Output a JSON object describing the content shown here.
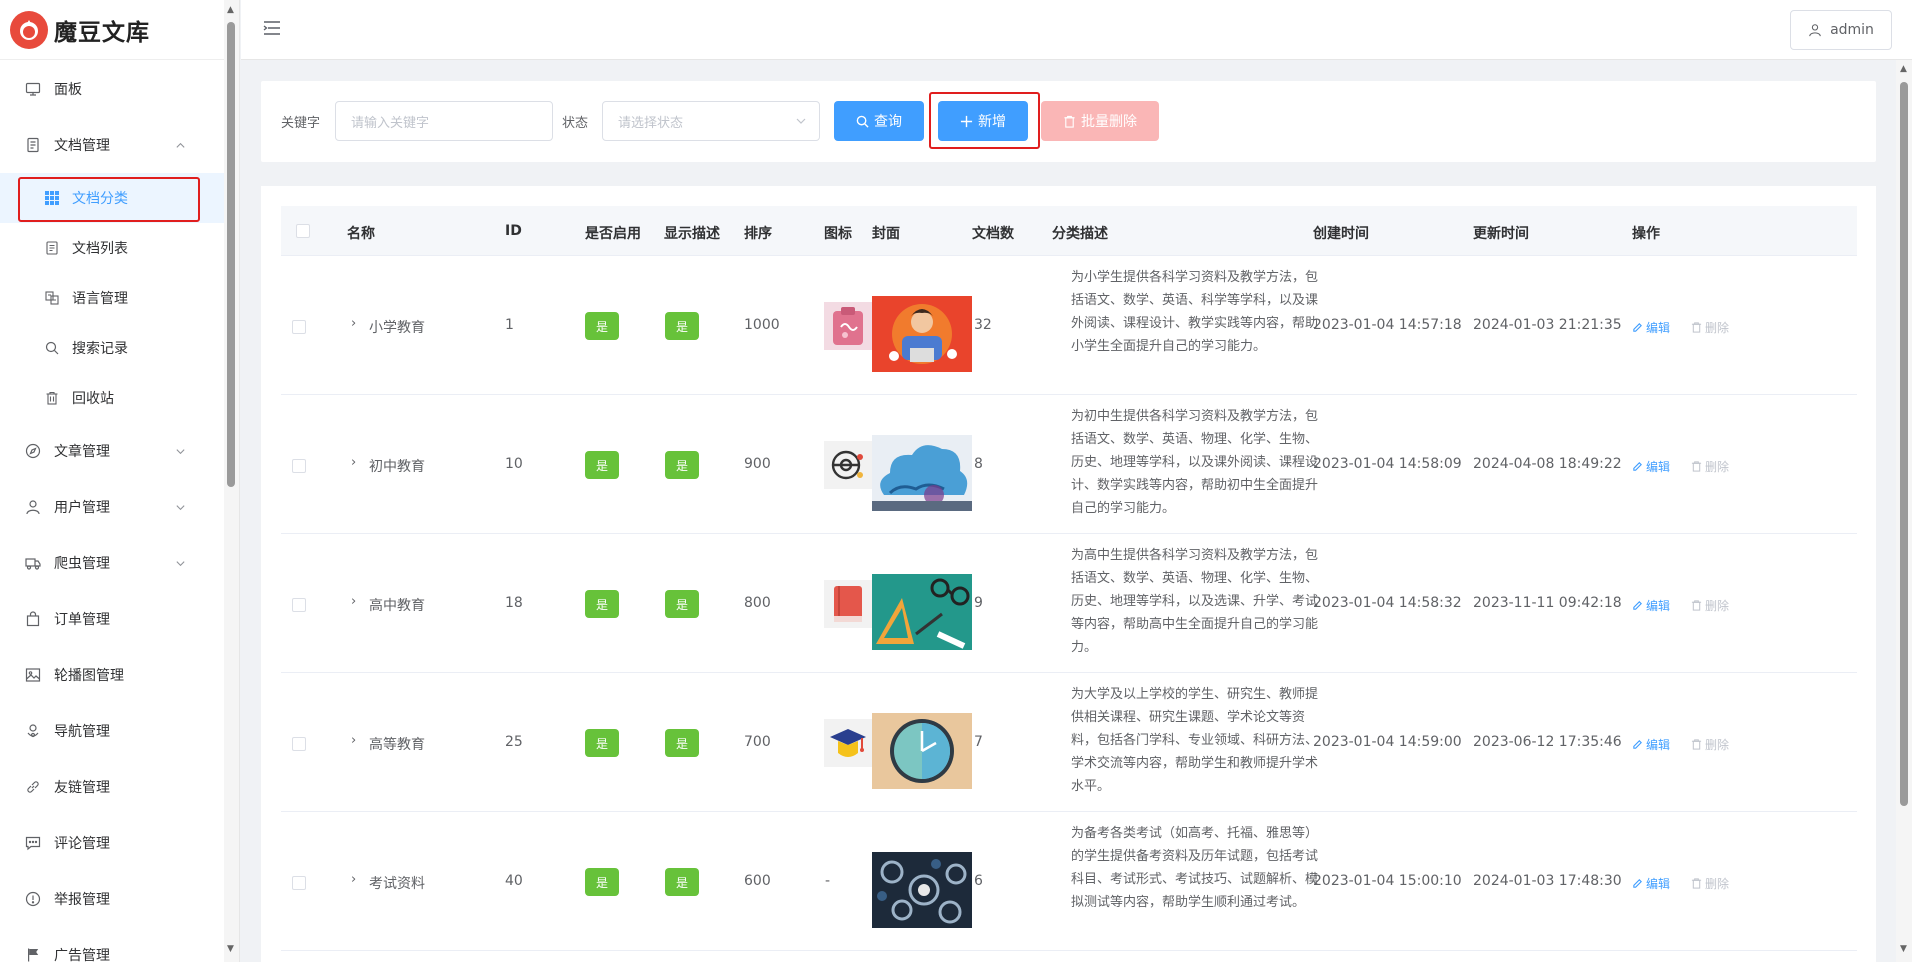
{
  "app": {
    "title": "魔豆文库"
  },
  "sidebar": {
    "items": [
      {
        "label": "面板",
        "icon": "monitor-icon"
      },
      {
        "label": "文档管理",
        "icon": "document-icon",
        "expanded": true
      },
      {
        "label": "文章管理",
        "icon": "compass-icon"
      },
      {
        "label": "用户管理",
        "icon": "user-icon"
      },
      {
        "label": "爬虫管理",
        "icon": "truck-icon"
      },
      {
        "label": "订单管理",
        "icon": "bag-icon"
      },
      {
        "label": "轮播图管理",
        "icon": "picture-icon"
      },
      {
        "label": "导航管理",
        "icon": "navigation-icon"
      },
      {
        "label": "友链管理",
        "icon": "link-icon"
      },
      {
        "label": "评论管理",
        "icon": "comment-icon"
      },
      {
        "label": "举报管理",
        "icon": "warning-icon"
      },
      {
        "label": "广告管理",
        "icon": "flag-icon"
      }
    ],
    "subitems": [
      {
        "label": "文档分类",
        "icon": "grid-icon",
        "active": true
      },
      {
        "label": "文档列表",
        "icon": "list-icon"
      },
      {
        "label": "语言管理",
        "icon": "translate-icon"
      },
      {
        "label": "搜索记录",
        "icon": "search-icon"
      },
      {
        "label": "回收站",
        "icon": "trash-icon"
      }
    ]
  },
  "header": {
    "user": "admin"
  },
  "filter": {
    "keyword_label": "关键字",
    "keyword_placeholder": "请输入关键字",
    "status_label": "状态",
    "status_placeholder": "请选择状态",
    "query_label": "查询",
    "add_label": "新增",
    "batch_delete_label": "批量删除"
  },
  "table": {
    "columns": [
      "名称",
      "ID",
      "是否启用",
      "显示描述",
      "排序",
      "图标",
      "封面",
      "文档数",
      "分类描述",
      "创建时间",
      "更新时间",
      "操作"
    ],
    "edit_label": "编辑",
    "delete_label": "删除",
    "rows": [
      {
        "name": "小学教育",
        "id": "1",
        "enabled": "是",
        "show_desc": "是",
        "sort": "1000",
        "icon": "clipboard-icon",
        "docs": "32",
        "desc": "为小学生提供各科学习资料及教学方法，包括语文、数学、英语、科学等学科，以及课外阅读、课程设计、教学实践等内容，帮助小学生全面提升自己的学习能力。",
        "created": "2023-01-04 14:57:18",
        "updated": "2024-01-03 21:21:35"
      },
      {
        "name": "初中教育",
        "id": "10",
        "enabled": "是",
        "show_desc": "是",
        "sort": "900",
        "icon": "atom-icon",
        "docs": "8",
        "desc": "为初中生提供各科学习资料及教学方法，包括语文、数学、英语、物理、化学、生物、历史、地理等学科，以及课外阅读、课程设计、数学实践等内容，帮助初中生全面提升自己的学习能力。",
        "created": "2023-01-04 14:58:09",
        "updated": "2024-04-08 18:49:22"
      },
      {
        "name": "高中教育",
        "id": "18",
        "enabled": "是",
        "show_desc": "是",
        "sort": "800",
        "icon": "book-icon",
        "docs": "9",
        "desc": "为高中生提供各科学习资料及教学方法，包括语文、数学、英语、物理、化学、生物、历史、地理等学科，以及选课、升学、考试等内容，帮助高中生全面提升自己的学习能力。",
        "created": "2023-01-04 14:58:32",
        "updated": "2023-11-11 09:42:18"
      },
      {
        "name": "高等教育",
        "id": "25",
        "enabled": "是",
        "show_desc": "是",
        "sort": "700",
        "icon": "graduation-cap-icon",
        "docs": "7",
        "desc": "为大学及以上学校的学生、研究生、教师提供相关课程、研究生课题、学术论文等资料，包括各门学科、专业领域、科研方法、学术交流等内容，帮助学生和教师提升学术水平。",
        "created": "2023-01-04 14:59:00",
        "updated": "2023-06-12 17:35:46"
      },
      {
        "name": "考试资料",
        "id": "40",
        "enabled": "是",
        "show_desc": "是",
        "sort": "600",
        "icon": "-",
        "docs": "6",
        "desc": "为备考各类考试（如高考、托福、雅思等）的学生提供备考资料及历年试题，包括考试科目、考试形式、考试技巧、试题解析、模拟测试等内容，帮助学生顺利通过考试。",
        "created": "2023-01-04 15:00:10",
        "updated": "2024-01-03 17:48:30"
      }
    ]
  },
  "colors": {
    "primary": "#409eff",
    "success": "#67c23a",
    "danger_light": "#fab6b6",
    "highlight": "#e01e1e"
  }
}
